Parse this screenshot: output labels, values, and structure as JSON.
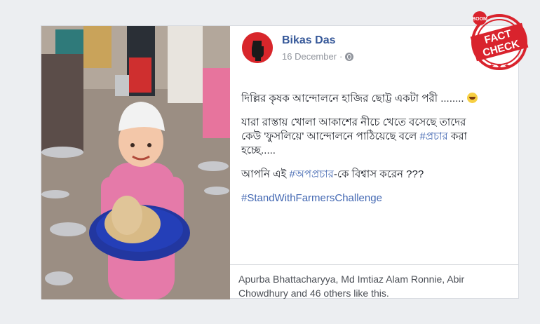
{
  "post": {
    "author": "Bikas Das",
    "date": "16 December",
    "separator": "·",
    "lines": {
      "line1": "দিল্লির কৃষক আন্দোলনে হাজির ছোট্ট একটা পরী ........",
      "line2_part1": "যারা রাস্তায় খোলা আকাশের নীচে খেতে বসেছে তাদের কেউ 'ফুসলিয়ে' আন্দোলনে পাঠিয়েছে বলে ",
      "line2_hashtag": "#প্রচার",
      "line2_part2": " করা হচ্ছে.....",
      "line3_part1": "আপনি এই ",
      "line3_hashtag": "#অপপ্রচার",
      "line3_part2": "-কে বিশ্বাস করেন ???",
      "hashtag_line": "#StandWithFarmersChallenge"
    },
    "likes_text": "Apurba Bhattacharyya, Md Imtiaz Alam Ronnie, Abir Chowdhury and 46 others like this.",
    "icons": {
      "avatar": "raised-fist-icon",
      "privacy": "globe-icon",
      "emoji": "grinning-face-icon"
    }
  },
  "stamp": {
    "top_text": "BOOM",
    "main_line1": "FACT",
    "main_line2": "CHECK",
    "color": "#d9232d"
  },
  "colors": {
    "link": "#365899",
    "hashtag": "#4267b2",
    "text": "#1d2129",
    "muted": "#90949c",
    "background": "#eceef1"
  }
}
